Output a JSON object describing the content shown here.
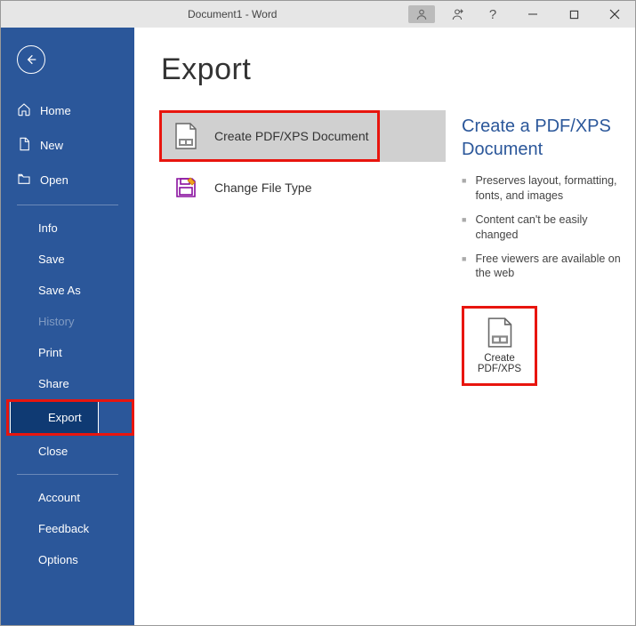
{
  "titlebar": {
    "title": "Document1  -  Word"
  },
  "sidebar": {
    "home": "Home",
    "new": "New",
    "open": "Open",
    "info": "Info",
    "save": "Save",
    "saveAs": "Save As",
    "history": "History",
    "print": "Print",
    "share": "Share",
    "export": "Export",
    "close": "Close",
    "account": "Account",
    "feedback": "Feedback",
    "options": "Options"
  },
  "page": {
    "title": "Export",
    "opt1": "Create PDF/XPS Document",
    "opt2": "Change File Type"
  },
  "panel": {
    "title": "Create a PDF/XPS Document",
    "b1": "Preserves layout, formatting, fonts, and images",
    "b2": "Content can't be easily changed",
    "b3": "Free viewers are available on the web",
    "btn": "Create PDF/XPS"
  }
}
